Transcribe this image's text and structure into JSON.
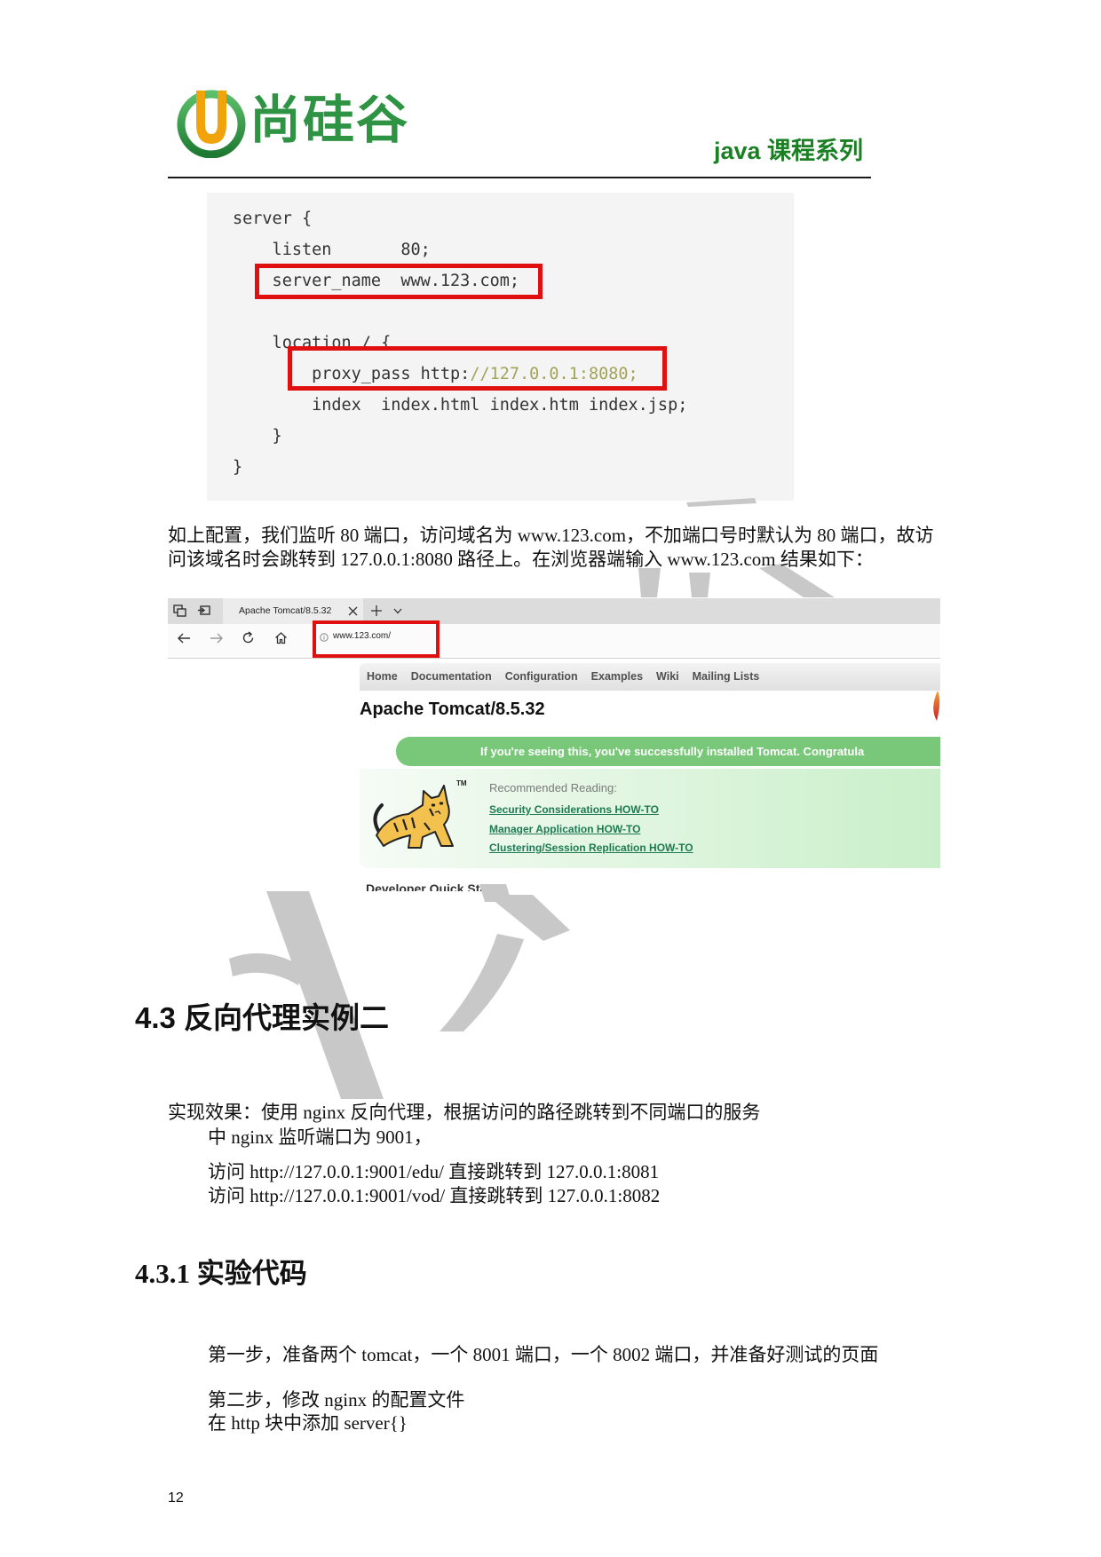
{
  "header": {
    "logo_text": "尚硅谷",
    "series_label": "java 课程系列"
  },
  "code_block": {
    "lines": [
      {
        "text": "server {"
      },
      {
        "text": "    listen       80;"
      },
      {
        "text": "    server_name  www.123.com;"
      },
      {
        "text": ""
      },
      {
        "text": "    location / {"
      },
      {
        "text": "        proxy_pass http:",
        "highlight": "//127.0.0.1:8080;"
      },
      {
        "text": "        index  index.html index.htm index.jsp;"
      },
      {
        "text": "    }"
      },
      {
        "text": "}"
      }
    ]
  },
  "intro_paragraph": {
    "lines": [
      "如上配置，我们监听 80 端口，访问域名为 www.123.com，不加端口号时默认为 80 端口，故访",
      "问该域名时会跳转到 127.0.0.1:8080 路径上。在浏览器端输入 www.123.com 结果如下："
    ]
  },
  "browser_screenshot": {
    "tab_title": "Apache Tomcat/8.5.32",
    "address": "www.123.com/",
    "nav_items": [
      "Home",
      "Documentation",
      "Configuration",
      "Examples",
      "Wiki",
      "Mailing Lists"
    ],
    "page_heading": "Apache Tomcat/8.5.32",
    "banner_text": "If you're seeing this, you've successfully installed Tomcat. Congratula",
    "logo_trademark": "TM",
    "recommended_heading": "Recommended Reading:",
    "links": [
      "Security Considerations HOW-TO",
      "Manager Application HOW-TO",
      "Clustering/Session Replication HOW-TO"
    ],
    "cut_off_heading": "Developer Quick Start",
    "icons": {
      "tab_manager": "tab-manager-icon",
      "set_aside_tabs": "set-aside-tabs-icon",
      "tab_close": "close-icon",
      "new_tab": "plus-icon",
      "tab_list": "chevron-down-icon",
      "back": "back-arrow-icon",
      "forward": "forward-arrow-icon",
      "refresh": "refresh-icon",
      "home": "home-icon",
      "site_info": "info-icon",
      "tomcat_logo": "tomcat-cat-logo",
      "apache_feather": "apache-feather-icon"
    }
  },
  "section_4_3": {
    "heading": "4.3 反向代理实例二",
    "effect_line": "实现效果：使用 nginx 反向代理，根据访问的路径跳转到不同端口的服务",
    "listen_line": "中 nginx 监听端口为 9001，",
    "routes": [
      "访问 http://127.0.0.1:9001/edu/ 直接跳转到 127.0.0.1:8081",
      "访问 http://127.0.0.1:9001/vod/ 直接跳转到 127.0.0.1:8082"
    ]
  },
  "section_4_3_1": {
    "heading": "4.3.1 实验代码",
    "step_1": "第一步，准备两个 tomcat，一个 8001 端口，一个 8002 端口，并准备好测试的页面",
    "step_2": "第二步，修改 nginx 的配置文件",
    "step_2_detail": "在 http 块中添加 server{}"
  },
  "footer": {
    "page_number": "12"
  },
  "colors": {
    "brand": "#2f9344",
    "series": "#1b7f24",
    "highlight": "#e01010",
    "code_bg": "#f4f4f4",
    "code_comment": "#a3a35a",
    "banner": "#79c879",
    "link": "#1d7a52",
    "watermark": "#c8c8c8"
  }
}
